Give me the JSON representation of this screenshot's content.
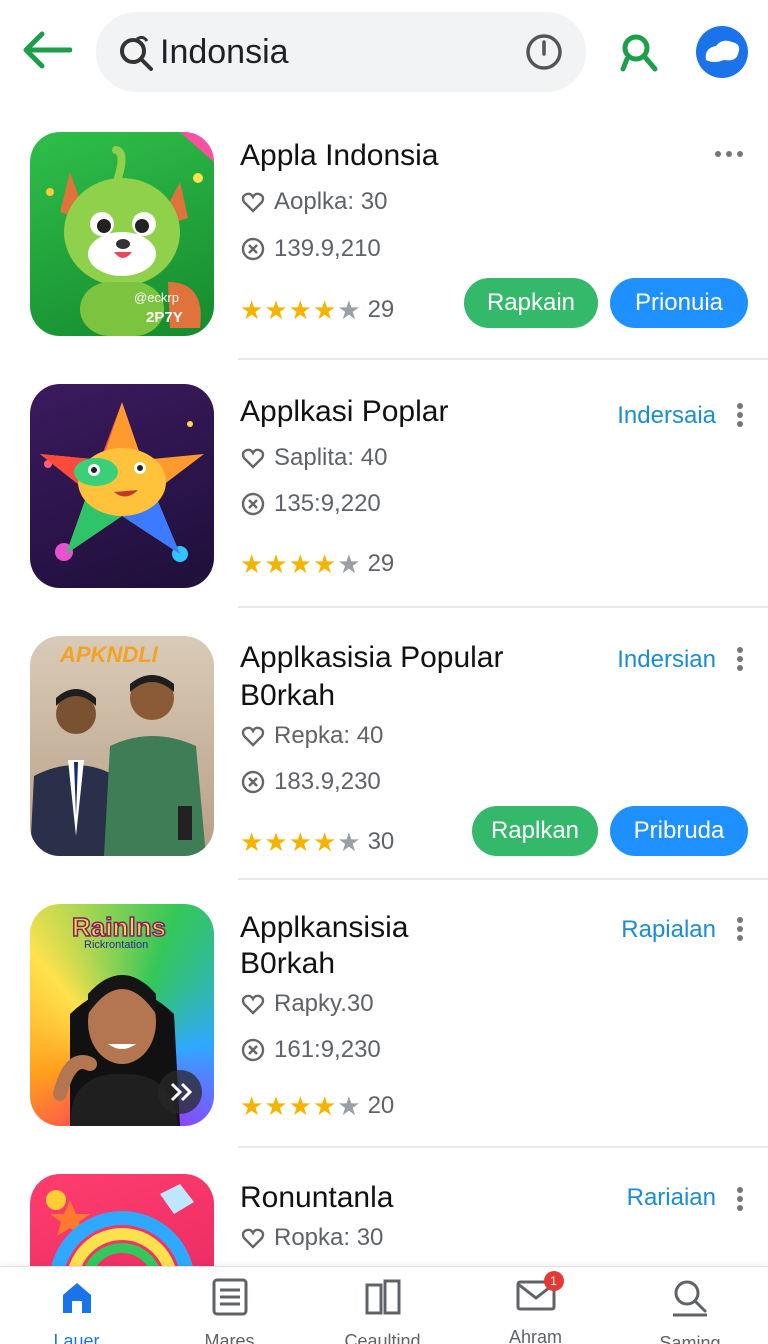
{
  "header": {
    "search_value": "Indonsia",
    "colors": {
      "back": "#1e9e4a",
      "avatar": "#1a73e8"
    }
  },
  "apps": [
    {
      "title_lines": [
        "Appla Indonsia"
      ],
      "meta1": "Aoplka: 30",
      "meta2": "139.9,210",
      "rating": 4,
      "rating_count": "29",
      "install_label": "Rapkain",
      "preorder_label": "Prionuia",
      "icon_text": [
        "@eckrp",
        "2P7Y"
      ]
    },
    {
      "title_lines": [
        "Applkasi Poplar"
      ],
      "meta1": "Saplita: 40",
      "meta2": "135:9,220",
      "rating": 4,
      "rating_count": "29",
      "link": "Indersaia"
    },
    {
      "title_lines": [
        "Applkasisia Popular",
        "B0rkah"
      ],
      "meta1": "Repka: 40",
      "meta2": "183.9,230",
      "rating": 4,
      "rating_count": "30",
      "link": "Indersian",
      "install_label": "Raplkan",
      "preorder_label": "Pribruda",
      "icon_text": [
        "APKNDLI"
      ]
    },
    {
      "title_lines": [
        "Applkansisia",
        "B0rkah"
      ],
      "meta1": "Rapky.30",
      "meta2": "161:9,230",
      "rating": 4,
      "rating_count": "20",
      "link": "Rapialan",
      "icon_text": [
        "Rainlns",
        "Rickrontation"
      ]
    },
    {
      "title_lines": [
        "Ronuntanla"
      ],
      "meta1": "Ropka: 30",
      "link": "Rariaian"
    }
  ],
  "nav": [
    {
      "label": "Lauer",
      "icon": "home-icon",
      "active": true
    },
    {
      "label": "Mares",
      "icon": "list-icon"
    },
    {
      "label": "Ceaultind",
      "icon": "book-icon"
    },
    {
      "label": "Ahram",
      "icon": "mail-icon",
      "badge": "1"
    },
    {
      "label": "Saming",
      "icon": "search-icon"
    }
  ]
}
